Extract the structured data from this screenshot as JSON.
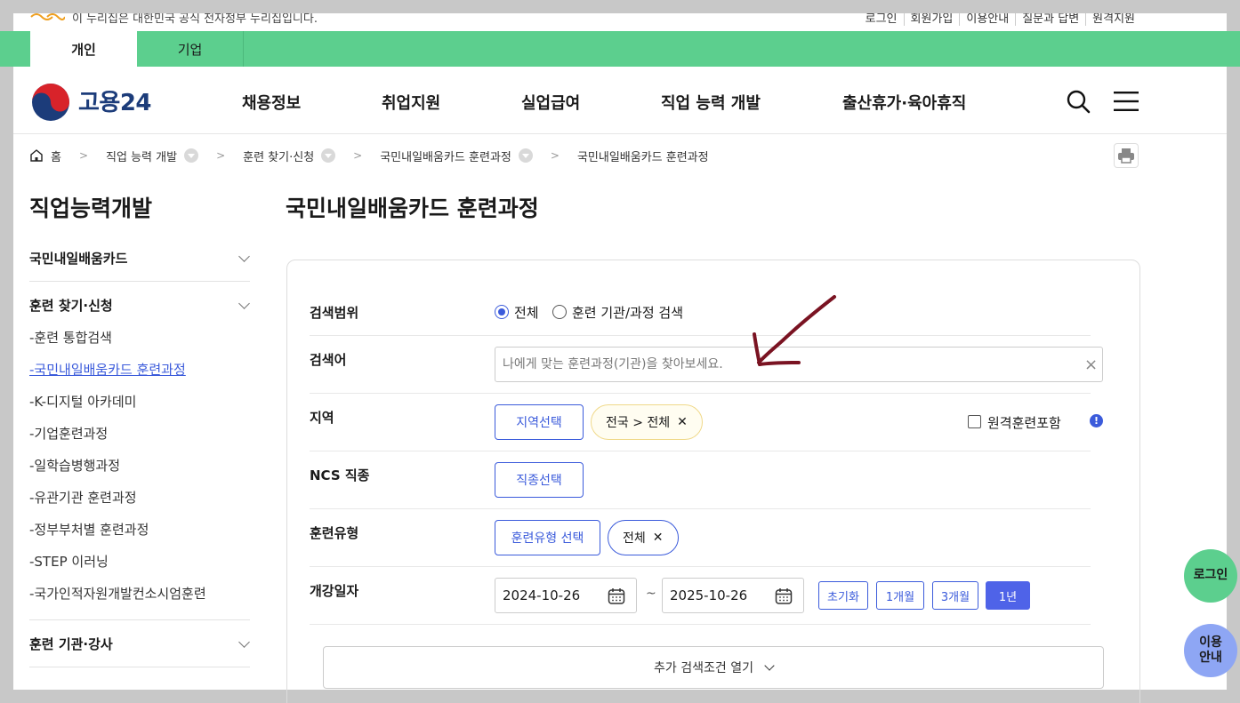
{
  "gov_bar": {
    "notice": "이 누리집은 대한민국 공식 전자정부 누리집입니다.",
    "links": [
      "로그인",
      "회원가입",
      "이용안내",
      "질문과 답변",
      "원격지원"
    ]
  },
  "user_tabs": [
    "개인",
    "기업"
  ],
  "header": {
    "logo_text": "고용24",
    "nav": [
      "채용정보",
      "취업지원",
      "실업급여",
      "직업 능력 개발",
      "출산휴가·육아휴직"
    ]
  },
  "breadcrumb": [
    "홈",
    "직업 능력 개발",
    "훈련 찾기·신청",
    "국민내일배움카드 훈련과정",
    "국민내일배움카드 훈련과정"
  ],
  "sidebar": {
    "title": "직업능력개발",
    "groups": [
      "국민내일배움카드",
      "훈련 찾기·신청",
      "훈련 기관·강사"
    ],
    "sub_items": [
      "-훈련 통합검색",
      "-국민내일배움카드 훈련과정",
      "-K-디지털 아카데미",
      "-기업훈련과정",
      "-일학습병행과정",
      "-유관기관 훈련과정",
      "-정부부처별 훈련과정",
      "-STEP 이러닝",
      "-국가인적자원개발컨소시엄훈련"
    ]
  },
  "main": {
    "title": "국민내일배움카드 훈련과정",
    "rows": {
      "scope_label": "검색범위",
      "scope_options": [
        "전체",
        "훈련 기관/과정 검색"
      ],
      "keyword_label": "검색어",
      "keyword_placeholder": "나에게 맞는 훈련과정(기관)을 찾아보세요.",
      "keyword_value": "",
      "region_label": "지역",
      "region_button": "지역선택",
      "region_chip": "전국 > 전체",
      "remote_label": "원격훈련포함",
      "ncs_label": "NCS 직종",
      "ncs_button": "직종선택",
      "type_label": "훈련유형",
      "type_button": "훈련유형 선택",
      "type_chip": "전체",
      "date_label": "개강일자",
      "date_start": "2024-10-26",
      "date_tilde": "~",
      "date_end": "2025-10-26",
      "period_buttons": [
        "초기화",
        "1개월",
        "3개월",
        "1년"
      ],
      "period_selected": "1년"
    },
    "more_button": "추가 검색조건 열기"
  },
  "floating": {
    "login": "로그인",
    "guide_line1": "이용",
    "guide_line2": "안내"
  },
  "colors": {
    "green": "#5ccf8e",
    "primary_blue": "#3b5bdb",
    "annotation_arrow": "#7a1322"
  }
}
